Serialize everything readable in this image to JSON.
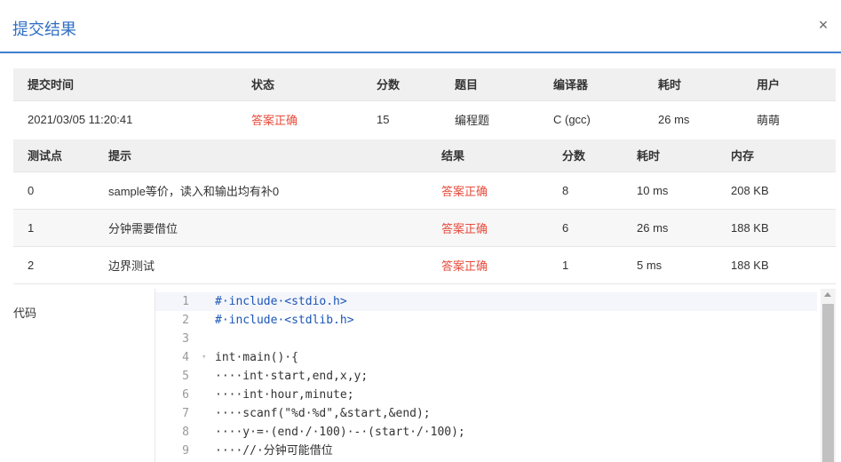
{
  "dialog": {
    "title": "提交结果",
    "close_label": "×"
  },
  "summary": {
    "headers": [
      "提交时间",
      "状态",
      "分数",
      "题目",
      "编译器",
      "耗时",
      "用户"
    ],
    "row": [
      "2021/03/05 11:20:41",
      "答案正确",
      "15",
      "编程题",
      "C (gcc)",
      "26 ms",
      "萌萌"
    ]
  },
  "tests": {
    "headers": [
      "测试点",
      "提示",
      "结果",
      "分数",
      "耗时",
      "内存"
    ],
    "rows": [
      [
        "0",
        "sample等价，读入和输出均有补0",
        "答案正确",
        "8",
        "10 ms",
        "208 KB"
      ],
      [
        "1",
        "分钟需要借位",
        "答案正确",
        "6",
        "26 ms",
        "188 KB"
      ],
      [
        "2",
        "边界测试",
        "答案正确",
        "1",
        "5 ms",
        "188 KB"
      ]
    ]
  },
  "code": {
    "label": "代码",
    "lines": [
      {
        "n": "1",
        "text": "#·include·<stdio.h>"
      },
      {
        "n": "2",
        "text": "#·include·<stdlib.h>"
      },
      {
        "n": "3",
        "text": ""
      },
      {
        "n": "4",
        "text": "int·main()·{",
        "fold": "▾"
      },
      {
        "n": "5",
        "text": "····int·start,end,x,y;"
      },
      {
        "n": "6",
        "text": "····int·hour,minute;"
      },
      {
        "n": "7",
        "text": "····scanf(\"%d·%d\",&start,&end);"
      },
      {
        "n": "8",
        "text": "····y·=·(end·/·100)·-·(start·/·100);"
      },
      {
        "n": "9",
        "text": "····//·分钟可能借位"
      }
    ]
  },
  "colors": {
    "accent": "#2f6fc4",
    "status_ok": "#e74c3c"
  }
}
